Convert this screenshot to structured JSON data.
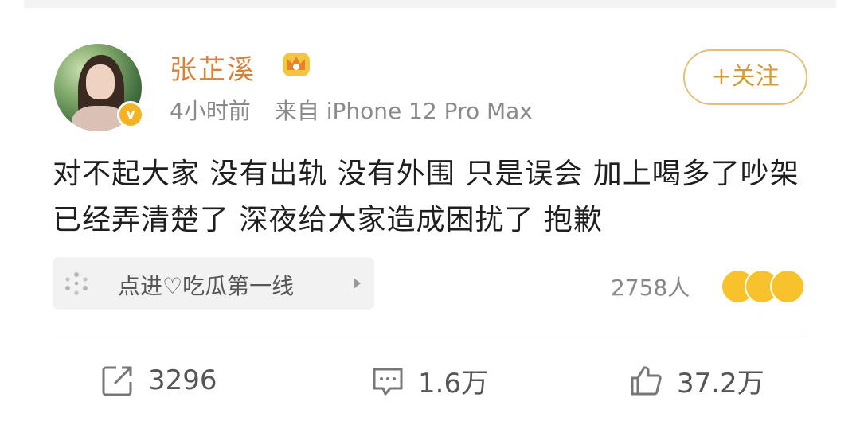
{
  "post": {
    "username": "张芷溪",
    "time": "4小时前",
    "source": "来自 iPhone 12 Pro Max",
    "follow_label": "+关注",
    "text": "对不起大家 没有出轨 没有外围 只是误会 加上喝多了吵架 已经弄清楚了 深夜给大家造成困扰了 抱歉"
  },
  "topic": {
    "label": "点进♡吃瓜第一线",
    "icon": "sparkle-icon"
  },
  "reactions": {
    "count": "2758人"
  },
  "actions": {
    "repost": "3296",
    "comment": "1.6万",
    "like": "37.2万"
  },
  "colors": {
    "username": "#d6813c",
    "follow_border": "#e3c07a",
    "verified": "#f5b324"
  }
}
